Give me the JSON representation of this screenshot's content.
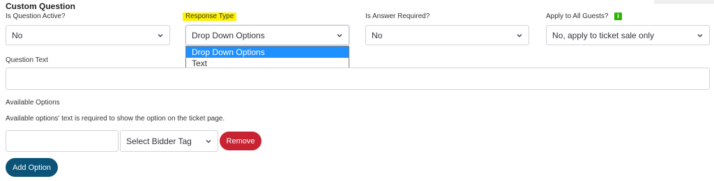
{
  "form": {
    "title": "Custom Question",
    "fields": {
      "is_active": {
        "label": "Is Question Active?",
        "value": "No"
      },
      "response_type": {
        "label": "Response Type",
        "value": "Drop Down Options"
      },
      "is_required": {
        "label": "Is Answer Required?",
        "value": "No"
      },
      "apply_all": {
        "label": "Apply to All Guests?",
        "value": "No, apply to ticket sale only"
      }
    },
    "response_type_options": [
      "Drop Down Options",
      "Text"
    ],
    "question_text": {
      "label": "Question Text",
      "value": ""
    },
    "available_options": {
      "label": "Available Options",
      "help": "Available options' text is required to show the option on the ticket page.",
      "option_text_value": "",
      "bidder_tag_value": "Select Bidder Tag",
      "remove_label": "Remove",
      "add_label": "Add Option"
    },
    "info_icon_text": "i"
  },
  "colors": {
    "highlight": "#fff200",
    "dropdown_active": "#1e90ff",
    "remove_button": "#c82333",
    "add_button": "#0b5377",
    "info_icon": "#2db400"
  }
}
